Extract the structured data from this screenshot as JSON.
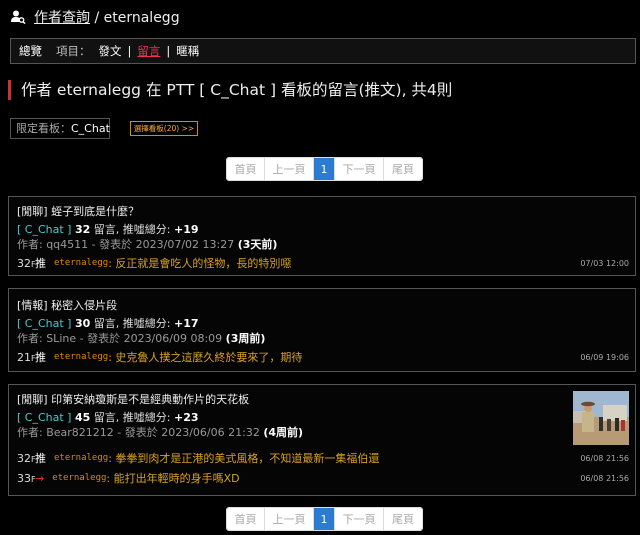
{
  "header": {
    "link": "作者查詢",
    "slash": " / ",
    "author": "eternalegg"
  },
  "tabs": {
    "total": "總覽",
    "label": "項目：",
    "items": [
      "發文",
      "留言",
      "暱稱"
    ],
    "sep": "|"
  },
  "heading": "作者 eternalegg 在 PTT [ C_Chat ] 看板的留言(推文), 共4則",
  "filter": {
    "label": "限定看板：",
    "value": "C_Chat"
  },
  "select_board": "選擇看板(20) >>",
  "pager": {
    "first": "首頁",
    "prev": "上一頁",
    "current": "1",
    "next": "下一頁",
    "last": "尾頁"
  },
  "posts": [
    {
      "title": "[閒聊] 蛭子到底是什麼？",
      "board": "[ C_Chat ]",
      "count": "32",
      "count_label": " 留言, 推噓總分: ",
      "score": "+19",
      "meta": "作者: qq4511 - 發表於 2023/07/02 13:27",
      "rel": "(3天前)",
      "comments": [
        {
          "floor": "32",
          "floor_unit": "F",
          "tag": "推",
          "user": "eternalegg",
          "text": ": 反正就是會吃人的怪物，長的特別噁",
          "time": "07/03 12:00"
        }
      ]
    },
    {
      "title": "[情報] 秘密入侵片段",
      "board": "[ C_Chat ]",
      "count": "30",
      "count_label": " 留言, 推噓總分: ",
      "score": "+17",
      "meta": "作者: SLine - 發表於 2023/06/09 08:09",
      "rel": "(3周前)",
      "comments": [
        {
          "floor": "21",
          "floor_unit": "F",
          "tag": "推",
          "user": "eternalegg",
          "text": ": 史克魯人撲之這麼久終於要來了，期待",
          "time": "06/09 19:06"
        }
      ]
    },
    {
      "title": "[閒聊] 印第安納瓊斯是不是經典動作片的天花板",
      "board": "[ C_Chat ]",
      "count": "45",
      "count_label": " 留言, 推噓總分: ",
      "score": "+23",
      "meta": "作者: Bear821212 - 發表於 2023/06/06 21:32",
      "rel": "(4周前)",
      "comments": [
        {
          "floor": "32",
          "floor_unit": "F",
          "tag": "推",
          "user": "eternalegg",
          "text": ": 拳拳到肉才是正港的美式風格，不知道最新一集福伯還",
          "time": "06/08 21:56"
        },
        {
          "floor": "33",
          "floor_unit": "F",
          "tag": "→",
          "user": "eternalegg",
          "text": ": 能打出年輕時的身手嗎XD",
          "time": "06/08 21:56"
        }
      ]
    }
  ]
}
